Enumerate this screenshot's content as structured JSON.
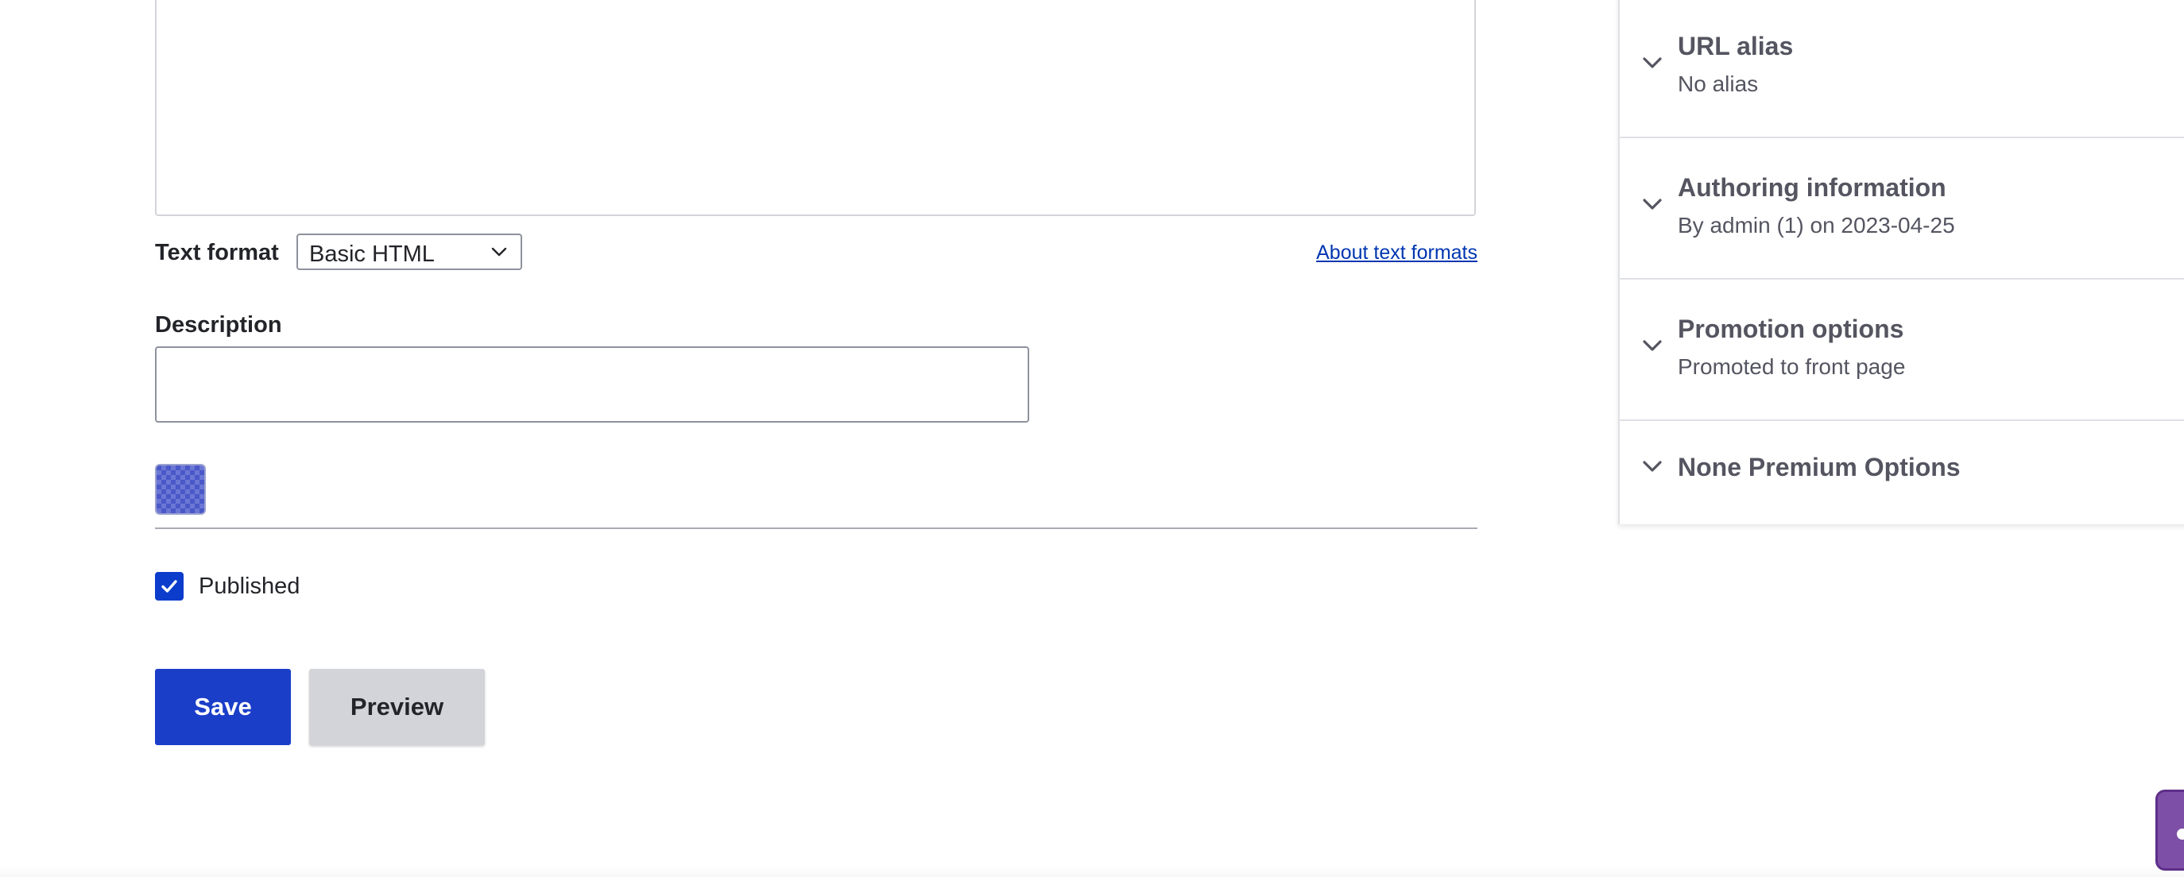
{
  "body_field": {
    "text_format_label": "Text format",
    "text_format_value": "Basic HTML",
    "about_link": "About text formats"
  },
  "description": {
    "label": "Description",
    "value": ""
  },
  "color_swatch": {
    "icon": "checkered-color-swatch",
    "color": "#4a58c8"
  },
  "published": {
    "label": "Published",
    "checked": true,
    "color": "#0b3ccc"
  },
  "actions": {
    "save_label": "Save",
    "preview_label": "Preview",
    "save_color": "#1b3ec9"
  },
  "sidebar": {
    "items": [
      {
        "title": "URL alias",
        "summary": "No alias"
      },
      {
        "title": "Authoring information",
        "summary": "By admin (1) on 2023-04-25"
      },
      {
        "title": "Promotion options",
        "summary": "Promoted to front page"
      },
      {
        "title": "None Premium Options"
      }
    ]
  },
  "floating_tab": {
    "icon": "help-tab-icon",
    "color": "#7d4fa6"
  }
}
